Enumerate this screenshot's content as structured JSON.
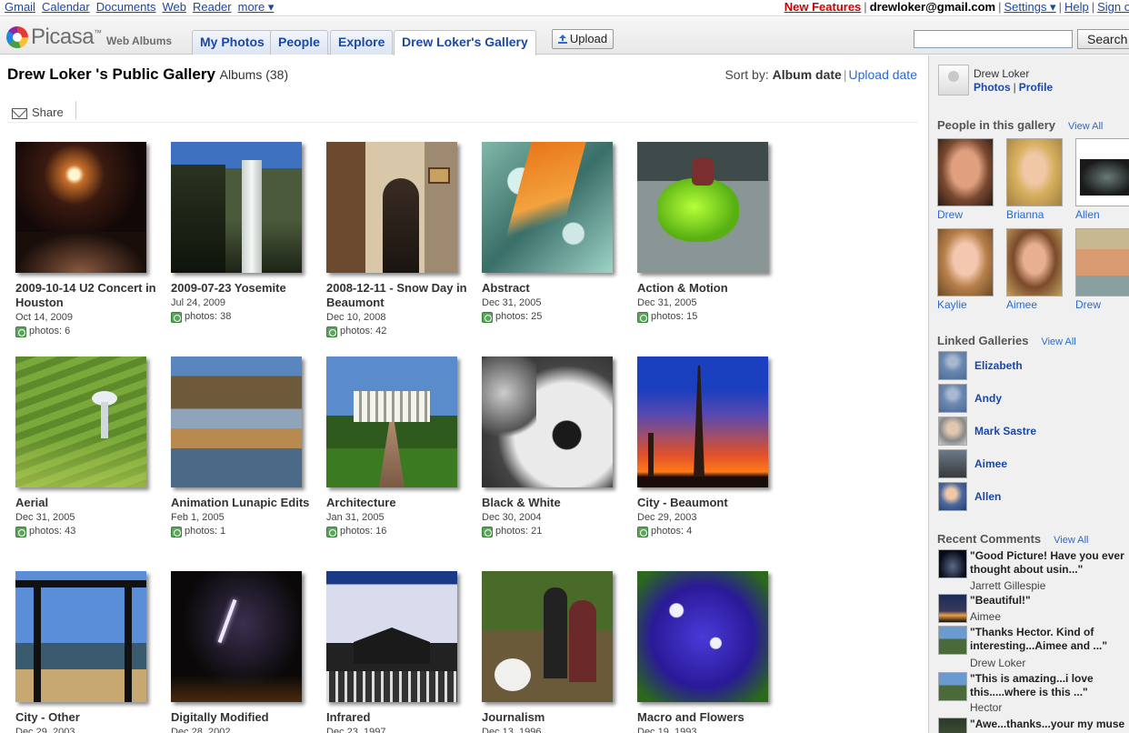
{
  "gbar": {
    "links": [
      "Gmail",
      "Calendar",
      "Documents",
      "Web",
      "Reader",
      "more ▾"
    ],
    "new_features": "New Features",
    "email": "drewloker@gmail.com",
    "settings": "Settings ▾",
    "help": "Help",
    "signout": "Sign o"
  },
  "header": {
    "logo_word": "Picasa",
    "logo_tm": "™",
    "logo_sub": "Web Albums",
    "tabs": [
      "My Photos",
      "People",
      "Explore",
      "Drew Loker's Gallery"
    ],
    "upload_label": "Upload",
    "search_button": "Search"
  },
  "gallery": {
    "title": "Drew Loker 's Public Gallery",
    "albums_count": "Albums (38)",
    "sort_label": "Sort by:",
    "sort_album_date": "Album date",
    "sort_upload_date": "Upload date",
    "share_label": "Share"
  },
  "albums": [
    {
      "title": "2009-10-14 U2 Concert in Houston",
      "date": "Oct 14, 2009",
      "photos": "photos: 6"
    },
    {
      "title": "2009-07-23 Yosemite",
      "date": "Jul 24, 2009",
      "photos": "photos: 38"
    },
    {
      "title": "2008-12-11 - Snow Day in Beaumont",
      "date": "Dec 10, 2008",
      "photos": "photos: 42"
    },
    {
      "title": "Abstract",
      "date": "Dec 31, 2005",
      "photos": "photos: 25"
    },
    {
      "title": "Action & Motion",
      "date": "Dec 31, 2005",
      "photos": "photos: 15"
    },
    {
      "title": "Aerial",
      "date": "Dec 31, 2005",
      "photos": "photos: 43"
    },
    {
      "title": "Animation Lunapic Edits",
      "date": "Feb 1, 2005",
      "photos": "photos: 1"
    },
    {
      "title": "Architecture",
      "date": "Jan 31, 2005",
      "photos": "photos: 16"
    },
    {
      "title": "Black & White",
      "date": "Dec 30, 2004",
      "photos": "photos: 21"
    },
    {
      "title": "City - Beaumont",
      "date": "Dec 29, 2003",
      "photos": "photos: 4"
    },
    {
      "title": "City - Other",
      "date": "Dec 29, 2003",
      "photos": ""
    },
    {
      "title": "Digitally Modified",
      "date": "Dec 28, 2002",
      "photos": ""
    },
    {
      "title": "Infrared",
      "date": "Dec 23, 1997",
      "photos": ""
    },
    {
      "title": "Journalism",
      "date": "Dec 13, 1996",
      "photos": ""
    },
    {
      "title": "Macro and Flowers",
      "date": "Dec 19, 1993",
      "photos": ""
    }
  ],
  "sidebar": {
    "owner_name": "Drew Loker",
    "owner_photos": "Photos",
    "owner_profile": "Profile",
    "people_heading": "People in this gallery",
    "view_all": "View All",
    "people": [
      "Drew",
      "Brianna",
      "Allen",
      "Kaylie",
      "Aimee",
      "Drew"
    ],
    "linked_heading": "Linked Galleries",
    "linked": [
      "Elizabeth",
      "Andy",
      "Mark Sastre",
      "Aimee",
      "Allen"
    ],
    "comments_heading": "Recent Comments",
    "comments": [
      {
        "text": "\"Good Picture! Have you ever thought about usin...\"",
        "author": "Jarrett Gillespie"
      },
      {
        "text": "\"Beautiful!\"",
        "author": "Aimee"
      },
      {
        "text": "\"Thanks Hector. Kind of interesting...Aimee and ...\"",
        "author": "Drew Loker"
      },
      {
        "text": "\"This is amazing...i love this.....where is this ...\"",
        "author": "Hector"
      },
      {
        "text": "\"Awe...thanks...your my muse",
        "author": ""
      }
    ]
  },
  "colors": {
    "link": "#1a47a8",
    "new_features": "#cc0000",
    "sidebar_bg": "#f0f0f0"
  }
}
